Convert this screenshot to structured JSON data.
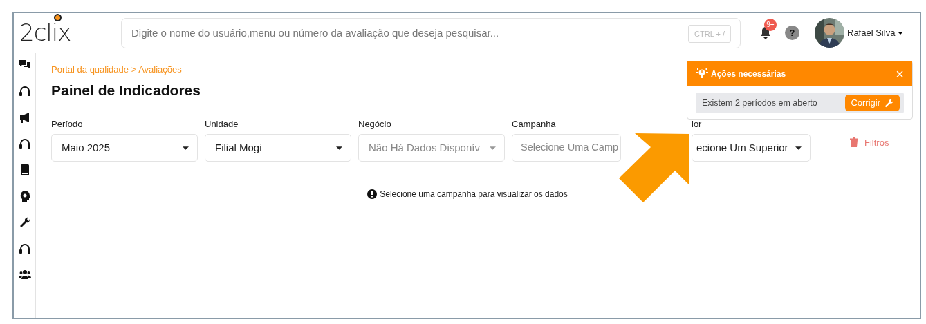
{
  "header": {
    "logo": "2clix",
    "search": {
      "placeholder": "Digite o nome do usuário,menu ou número da avaliação que deseja pesquisar...",
      "shortcut": "CTRL + /"
    },
    "notifications": {
      "badge": "9+"
    },
    "help": "?",
    "user": {
      "name": "Rafael Silva"
    }
  },
  "sidebar": {
    "items": [
      {
        "kind": "comments"
      },
      {
        "kind": "headset"
      },
      {
        "kind": "bullhorn"
      },
      {
        "kind": "headset"
      },
      {
        "kind": "book"
      },
      {
        "kind": "head-gear"
      },
      {
        "kind": "wrench"
      },
      {
        "kind": "headset"
      },
      {
        "kind": "users"
      }
    ]
  },
  "breadcrumb": "Portal da qualidade > Avaliações",
  "title": "Painel de Indicadores",
  "alert": {
    "title": "Ações necessárias",
    "close": "×",
    "message": "Existem 2 períodos em aberto",
    "button": "Corrigir"
  },
  "filters": [
    {
      "label": "Período",
      "value": "Maio 2025"
    },
    {
      "label": "Unidade",
      "value": "Filial Mogi"
    },
    {
      "label": "Negócio",
      "placeholder": "Não Há Dados Disponív"
    },
    {
      "label": "Campanha",
      "placeholder": "Selecione Uma Camp"
    },
    {
      "label": "ior",
      "value": "ecione Um Superior"
    }
  ],
  "clear_filters": "Filtros",
  "empty_message": "Selecione uma campanha para visualizar os dados"
}
